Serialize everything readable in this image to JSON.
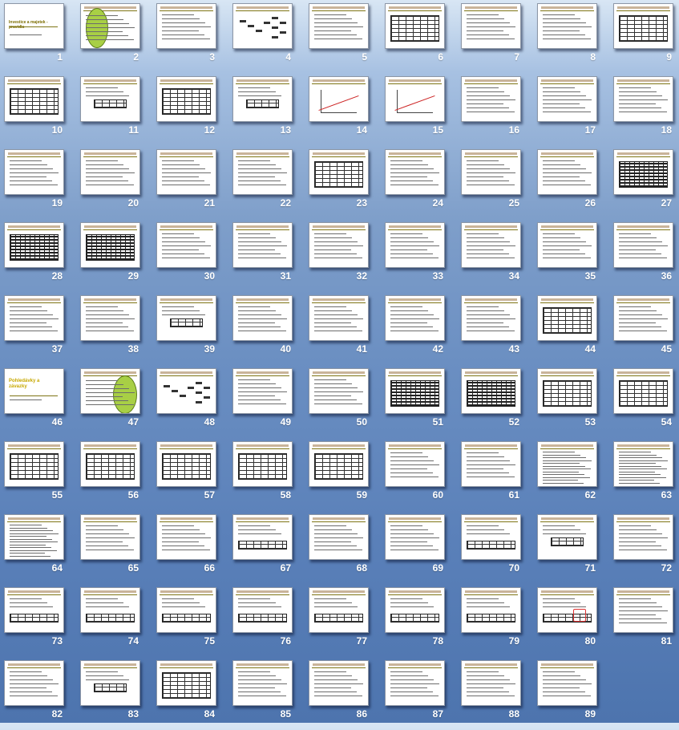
{
  "window": {
    "view": "slide-sorter"
  },
  "colors": {
    "accent_underline": "#7e7414",
    "number_text": "#ffffff",
    "highlight_ellipse": "#a8cf45",
    "annotation_red": "#cc2222"
  },
  "slides": [
    {
      "number": "1",
      "kind": "title",
      "title": "Investice a majetek - pravidla"
    },
    {
      "number": "2",
      "kind": "ellipse-list"
    },
    {
      "number": "3",
      "kind": "text"
    },
    {
      "number": "4",
      "kind": "diagram"
    },
    {
      "number": "5",
      "kind": "text"
    },
    {
      "number": "6",
      "kind": "table"
    },
    {
      "number": "7",
      "kind": "text"
    },
    {
      "number": "8",
      "kind": "text"
    },
    {
      "number": "9",
      "kind": "table"
    },
    {
      "number": "10",
      "kind": "table"
    },
    {
      "number": "11",
      "kind": "small-table"
    },
    {
      "number": "12",
      "kind": "table"
    },
    {
      "number": "13",
      "kind": "small-table"
    },
    {
      "number": "14",
      "kind": "chart"
    },
    {
      "number": "15",
      "kind": "chart"
    },
    {
      "number": "16",
      "kind": "text"
    },
    {
      "number": "17",
      "kind": "text"
    },
    {
      "number": "18",
      "kind": "text"
    },
    {
      "number": "19",
      "kind": "text"
    },
    {
      "number": "20",
      "kind": "text"
    },
    {
      "number": "21",
      "kind": "text"
    },
    {
      "number": "22",
      "kind": "text"
    },
    {
      "number": "23",
      "kind": "table"
    },
    {
      "number": "24",
      "kind": "text"
    },
    {
      "number": "25",
      "kind": "text"
    },
    {
      "number": "26",
      "kind": "text"
    },
    {
      "number": "27",
      "kind": "dark-table"
    },
    {
      "number": "28",
      "kind": "dark-table"
    },
    {
      "number": "29",
      "kind": "dark-table"
    },
    {
      "number": "30",
      "kind": "text"
    },
    {
      "number": "31",
      "kind": "text"
    },
    {
      "number": "32",
      "kind": "text"
    },
    {
      "number": "33",
      "kind": "text"
    },
    {
      "number": "34",
      "kind": "text"
    },
    {
      "number": "35",
      "kind": "text"
    },
    {
      "number": "36",
      "kind": "text"
    },
    {
      "number": "37",
      "kind": "text"
    },
    {
      "number": "38",
      "kind": "text"
    },
    {
      "number": "39",
      "kind": "small-table"
    },
    {
      "number": "40",
      "kind": "text"
    },
    {
      "number": "41",
      "kind": "text"
    },
    {
      "number": "42",
      "kind": "text"
    },
    {
      "number": "43",
      "kind": "text"
    },
    {
      "number": "44",
      "kind": "table"
    },
    {
      "number": "45",
      "kind": "text"
    },
    {
      "number": "46",
      "kind": "title",
      "title": "Pohledávky a závazky"
    },
    {
      "number": "47",
      "kind": "ellipse-list"
    },
    {
      "number": "48",
      "kind": "diagram"
    },
    {
      "number": "49",
      "kind": "text"
    },
    {
      "number": "50",
      "kind": "text"
    },
    {
      "number": "51",
      "kind": "dark-table"
    },
    {
      "number": "52",
      "kind": "dark-table"
    },
    {
      "number": "53",
      "kind": "table"
    },
    {
      "number": "54",
      "kind": "table"
    },
    {
      "number": "55",
      "kind": "table"
    },
    {
      "number": "56",
      "kind": "table"
    },
    {
      "number": "57",
      "kind": "table"
    },
    {
      "number": "58",
      "kind": "table"
    },
    {
      "number": "59",
      "kind": "table"
    },
    {
      "number": "60",
      "kind": "text"
    },
    {
      "number": "61",
      "kind": "text"
    },
    {
      "number": "62",
      "kind": "dense-text"
    },
    {
      "number": "63",
      "kind": "dense-text"
    },
    {
      "number": "64",
      "kind": "dense-text"
    },
    {
      "number": "65",
      "kind": "text"
    },
    {
      "number": "66",
      "kind": "text"
    },
    {
      "number": "67",
      "kind": "wide-table"
    },
    {
      "number": "68",
      "kind": "text"
    },
    {
      "number": "69",
      "kind": "text"
    },
    {
      "number": "70",
      "kind": "wide-table"
    },
    {
      "number": "71",
      "kind": "small-table"
    },
    {
      "number": "72",
      "kind": "text"
    },
    {
      "number": "73",
      "kind": "wide-table"
    },
    {
      "number": "74",
      "kind": "wide-table"
    },
    {
      "number": "75",
      "kind": "wide-table"
    },
    {
      "number": "76",
      "kind": "wide-table"
    },
    {
      "number": "77",
      "kind": "wide-table"
    },
    {
      "number": "78",
      "kind": "wide-table"
    },
    {
      "number": "79",
      "kind": "wide-table"
    },
    {
      "number": "80",
      "kind": "wide-table"
    },
    {
      "number": "81",
      "kind": "text"
    },
    {
      "number": "82",
      "kind": "text"
    },
    {
      "number": "83",
      "kind": "small-table"
    },
    {
      "number": "84",
      "kind": "table"
    },
    {
      "number": "85",
      "kind": "text"
    },
    {
      "number": "86",
      "kind": "text"
    },
    {
      "number": "87",
      "kind": "text"
    },
    {
      "number": "88",
      "kind": "text"
    },
    {
      "number": "89",
      "kind": "text"
    }
  ]
}
